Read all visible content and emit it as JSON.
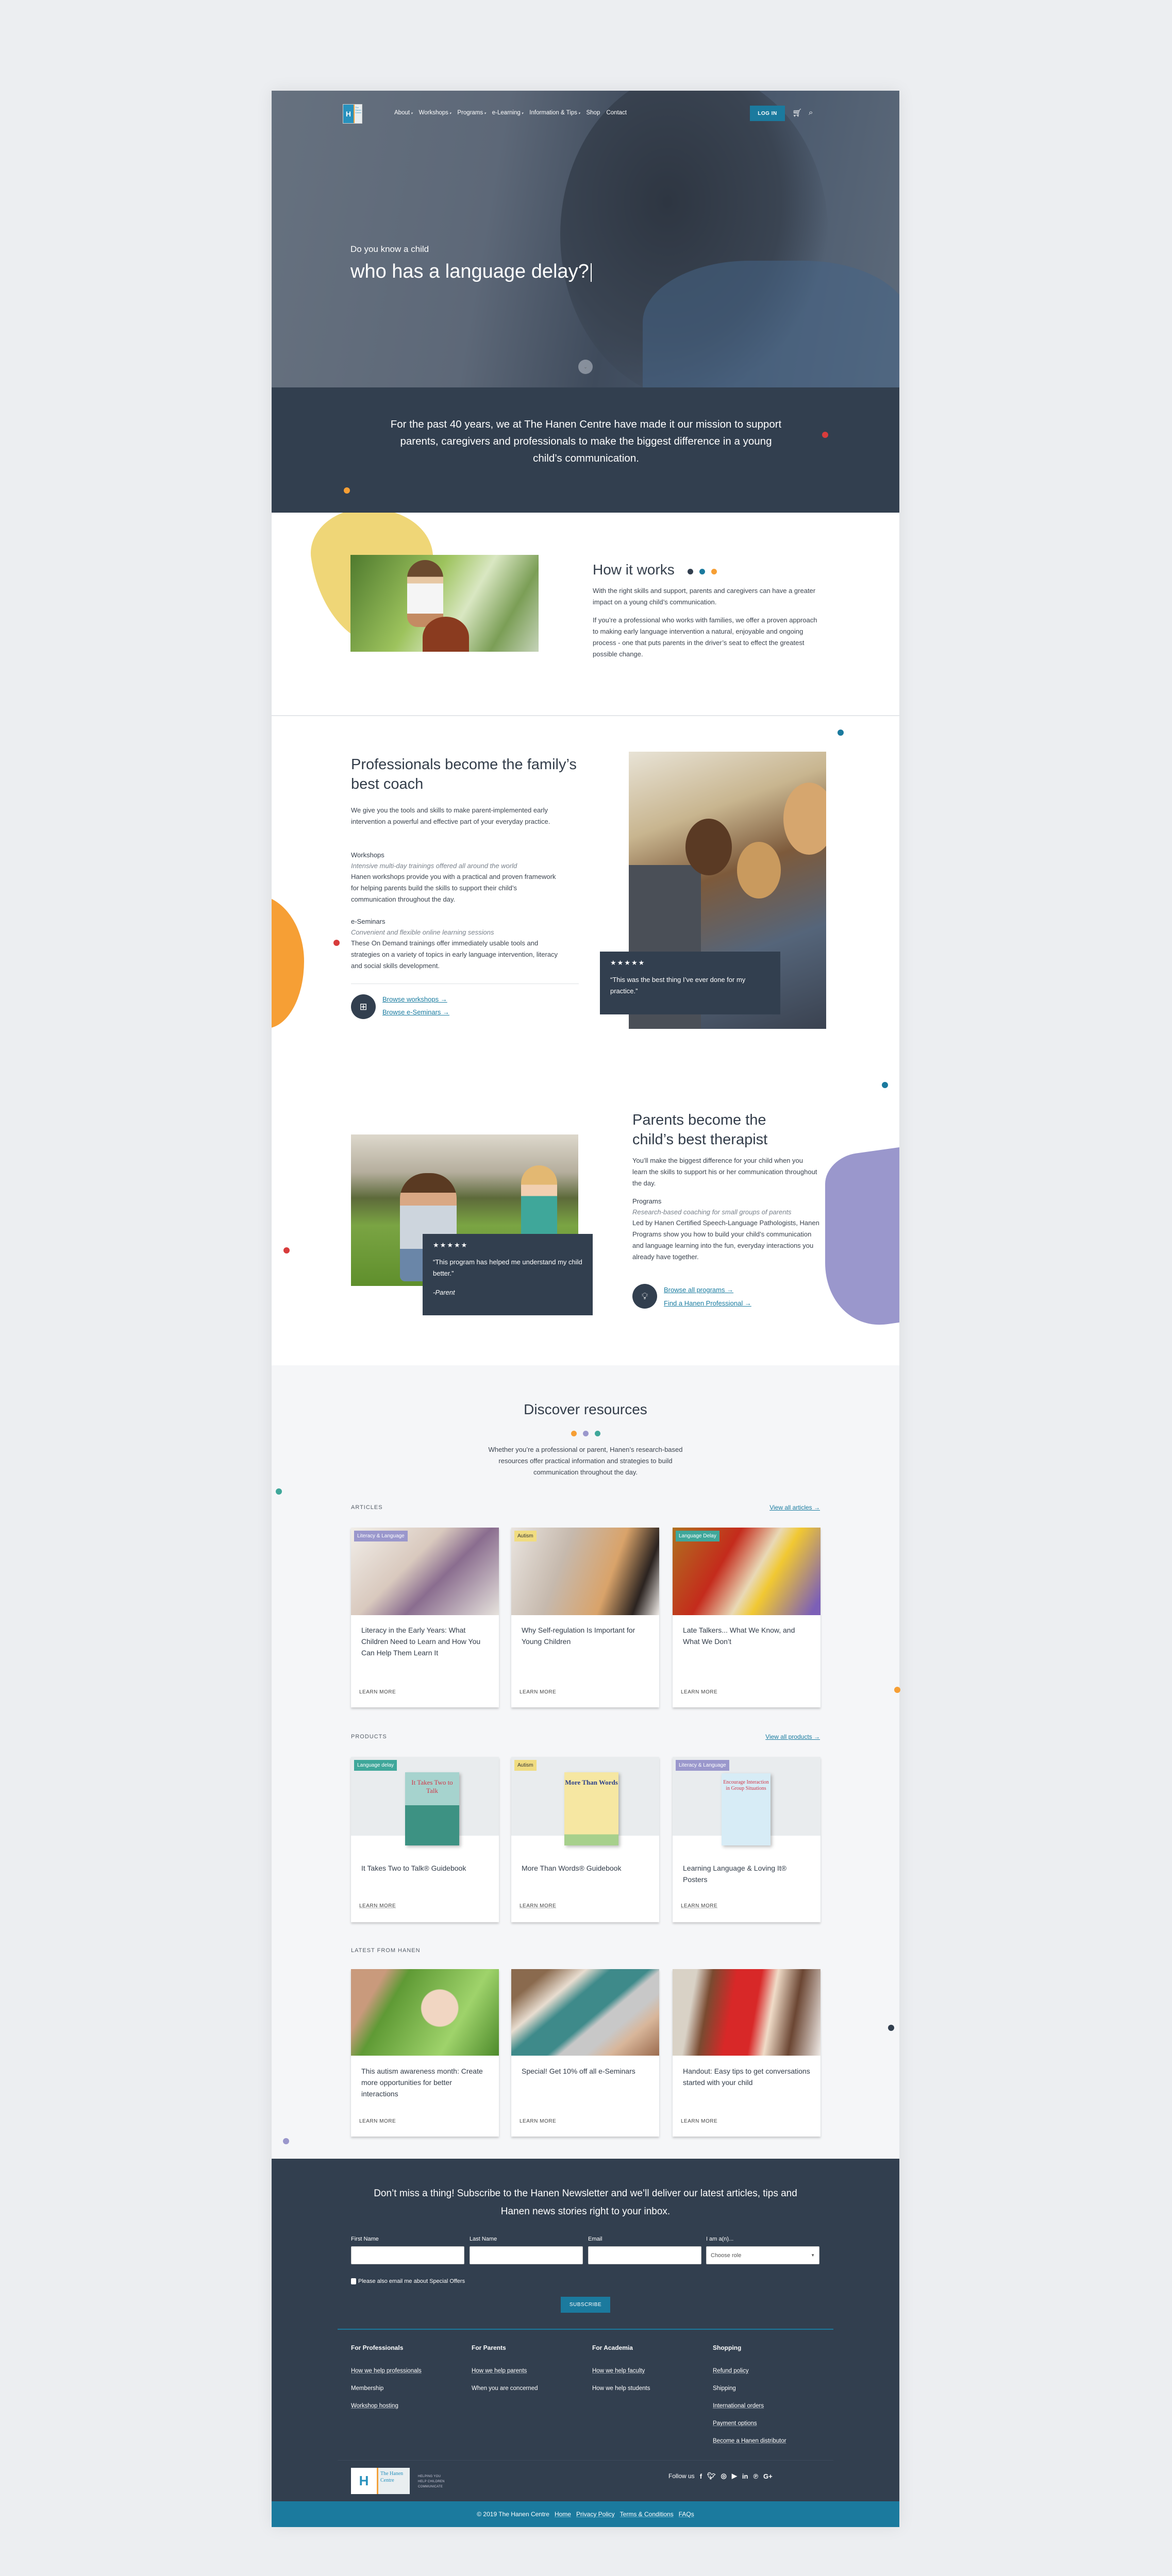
{
  "colors": {
    "navy": "#323f4f",
    "teal": "#1b7a9e",
    "yellow": "#efd677",
    "orange": "#f69f35",
    "purple": "#9a97cc",
    "red": "#d83c3c",
    "green": "#3fa79a"
  },
  "header": {
    "logo_text": "The Hanen Centre",
    "nav": [
      {
        "label": "About",
        "dropdown": true
      },
      {
        "label": "Workshops",
        "dropdown": true
      },
      {
        "label": "Programs",
        "dropdown": true
      },
      {
        "label": "e-Learning",
        "dropdown": true
      },
      {
        "label": "Information & Tips",
        "dropdown": true
      },
      {
        "label": "Shop",
        "dropdown": false
      },
      {
        "label": "Contact",
        "dropdown": false
      }
    ],
    "login_label": "LOG IN",
    "icons": [
      "cart-icon",
      "search-icon"
    ]
  },
  "hero": {
    "line1": "Do you know a child",
    "line2": "who has a language delay?"
  },
  "mission": {
    "text": "For the past 40 years, we at The Hanen Centre have made it our mission to support parents, caregivers and professionals to make the biggest difference in a young child’s communication."
  },
  "how": {
    "title": "How it works",
    "p1": "With the right skills and support, parents and caregivers can have a greater impact on a young child’s communication.",
    "p2": "If you’re a professional who works with families, we offer a proven approach to making early language intervention a natural, enjoyable and ongoing process - one that puts parents in the driver’s seat to effect the greatest possible change."
  },
  "professionals": {
    "title": "Professionals become the family’s best coach",
    "intro": "We give you the tools and skills to make parent-implemented early intervention a powerful and effective part of your everyday practice.",
    "items": [
      {
        "title": "Workshops",
        "subtitle": "Intensive multi-day trainings offered all around the world",
        "text": "Hanen workshops provide you with a practical and proven framework for helping parents build the skills to support their child’s communication throughout the day."
      },
      {
        "title": "e-Seminars",
        "subtitle": "Convenient and flexible online learning sessions",
        "text": "These On Demand trainings offer immediately usable tools and strategies on a variety of topics in early language intervention, literacy and social skills development."
      }
    ],
    "links": [
      "Browse workshops →",
      "Browse e-Seminars →"
    ],
    "quote": {
      "rating": 5,
      "text": "“This was the best thing I’ve ever done for my practice.”"
    }
  },
  "parents": {
    "title": "Parents become the child’s best therapist",
    "intro": "You’ll make the biggest difference for your child when you learn the skills to support his or her communication throughout the day.",
    "item": {
      "title": "Programs",
      "subtitle": "Research-based coaching for small groups of parents",
      "text": "Led by Hanen Certified Speech-Language Pathologists, Hanen Programs show you how to build your child’s communication and language learning into the fun, everyday interactions you already have together."
    },
    "links": [
      "Browse all programs →",
      "Find a Hanen Professional →"
    ],
    "quote": {
      "rating": 5,
      "text": "“This program has helped me understand my child better.”",
      "author": "-Parent"
    }
  },
  "discover": {
    "title": "Discover resources",
    "description": "Whether you’re a professional or parent, Hanen’s research-based resources offer practical information and strategies to build communication throughout the day.",
    "articles": {
      "label": "ARTICLES",
      "view_all": "View all articles →",
      "items": [
        {
          "tag": "Literacy & Language",
          "title": "Literacy in the Early Years: What Children Need to Learn and How You Can Help Them Learn It",
          "cta": "LEARN MORE"
        },
        {
          "tag": "Autism",
          "title": "Why Self-regulation Is Important for Young Children",
          "cta": "LEARN MORE"
        },
        {
          "tag": "Language Delay",
          "title": "Late Talkers... What We Know, and What We Don’t",
          "cta": "LEARN MORE"
        }
      ]
    },
    "products": {
      "label": "PRODUCTS",
      "view_all": "View all products →",
      "items": [
        {
          "tag": "Language delay",
          "title": "It Takes Two to Talk® Guidebook",
          "cover": "It Takes Two to Talk",
          "cta": "LEARN MORE"
        },
        {
          "tag": "Autism",
          "title": "More Than Words® Guidebook",
          "cover": "More Than Words",
          "cta": "LEARN MORE"
        },
        {
          "tag": "Literacy & Language",
          "title": "Learning Language & Loving It® Posters",
          "cover": "Encourage Interaction in Group Situations",
          "cta": "LEARN MORE"
        }
      ]
    },
    "latest": {
      "label": "LATEST FROM HANEN",
      "items": [
        {
          "title": "This autism awareness month: Create more opportunities for better interactions",
          "cta": "LEARN MORE"
        },
        {
          "title": "Special! Get 10% off all e-Seminars",
          "cta": "LEARN MORE"
        },
        {
          "title": "Handout: Easy tips to get conversations started with your child",
          "cta": "LEARN MORE"
        }
      ]
    }
  },
  "newsletter": {
    "heading": "Don’t miss a thing! Subscribe to the Hanen Newsletter and we’ll deliver our latest articles, tips and Hanen news stories right to your inbox.",
    "fields": [
      {
        "label": "First Name",
        "value": ""
      },
      {
        "label": "Last Name",
        "value": ""
      },
      {
        "label": "Email",
        "value": ""
      }
    ],
    "role": {
      "label": "I am a(n)...",
      "value": "Choose role"
    },
    "checkbox_label": "Please also email me about Special Offers",
    "checked": false,
    "subscribe": "SUBSCRIBE"
  },
  "footer": {
    "columns": [
      {
        "title": "For Professionals",
        "links": [
          "How we help professionals",
          "Membership",
          "Workshop hosting"
        ]
      },
      {
        "title": "For Parents",
        "links": [
          "How we help parents",
          "When you are concerned"
        ]
      },
      {
        "title": "For Academia",
        "links": [
          "How we help faculty",
          "How we help students"
        ]
      },
      {
        "title": "Shopping",
        "links": [
          "Refund policy",
          "Shipping",
          "International orders",
          "Payment options",
          "Become a Hanen distributor"
        ]
      }
    ],
    "logo_text": "The Hanen Centre",
    "tagline": "HELPING YOU HELP CHILDREN COMMUNICATE",
    "follow": "Follow us",
    "social": [
      "facebook",
      "twitter",
      "instagram",
      "youtube",
      "linkedin",
      "pinterest",
      "google-plus"
    ],
    "copyright": "© 2019 The Hanen Centre",
    "bottom_links": [
      "Home",
      "Privacy Policy",
      "Terms & Conditions",
      "FAQs"
    ]
  }
}
